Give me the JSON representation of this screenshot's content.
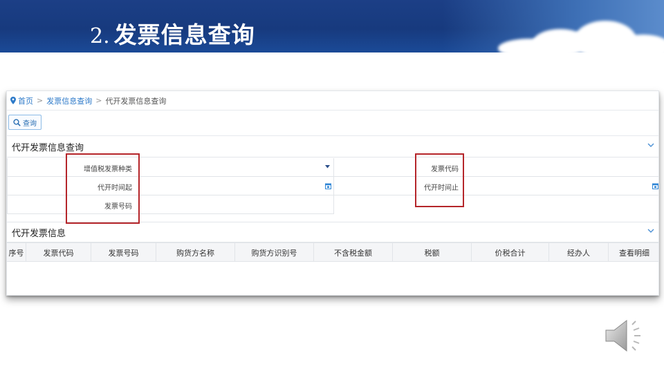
{
  "slide": {
    "number": "2.",
    "title": "发票信息查询"
  },
  "breadcrumb": {
    "home": "首页",
    "sep": ">",
    "level1": "发票信息查询",
    "current": "代开发票信息查询"
  },
  "toolbar": {
    "query_label": "查询"
  },
  "query_section": {
    "title": "代开发票信息查询",
    "fields": {
      "invoice_type": {
        "label": "增值税发票种类",
        "value": ""
      },
      "invoice_code": {
        "label": "发票代码",
        "value": ""
      },
      "start_time": {
        "label": "代开时间起",
        "value": ""
      },
      "end_time": {
        "label": "代开时间止",
        "value": ""
      },
      "invoice_number": {
        "label": "发票号码",
        "value": ""
      }
    }
  },
  "result_section": {
    "title": "代开发票信息",
    "columns": [
      "序号",
      "发票代码",
      "发票号码",
      "购货方名称",
      "购货方识别号",
      "不含税金额",
      "税额",
      "价税合计",
      "经办人",
      "查看明细"
    ],
    "rows": []
  },
  "colors": {
    "banner": "#1c3f86",
    "link": "#2d7ac9",
    "highlight": "#b5252a",
    "icon": "#2f86d6"
  }
}
